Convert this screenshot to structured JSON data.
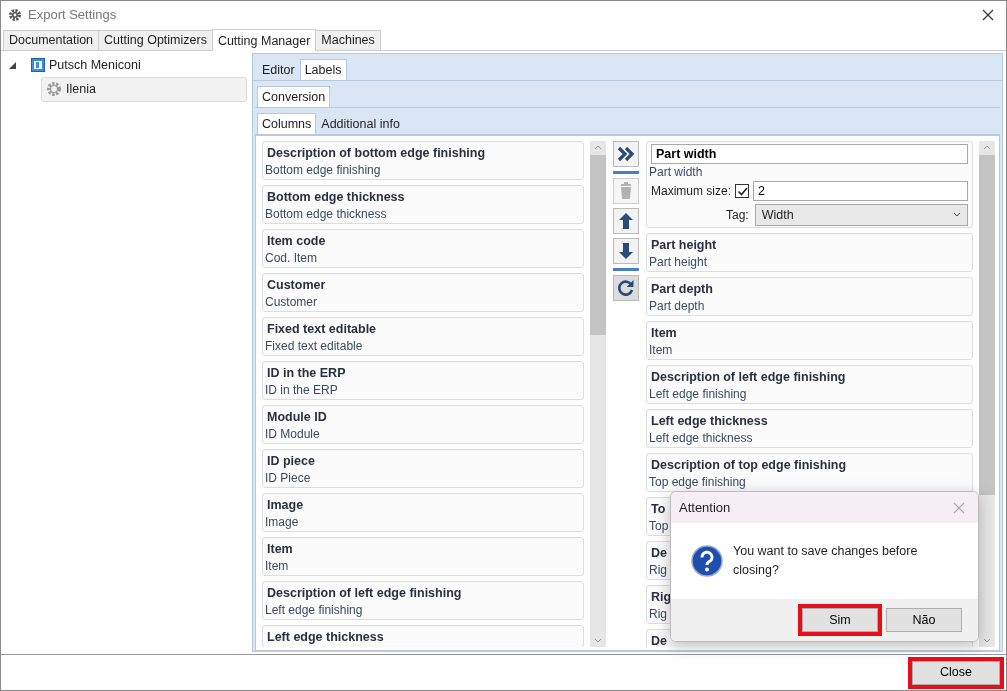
{
  "window": {
    "title": "Export Settings"
  },
  "tabs": [
    {
      "label": "Documentation",
      "selected": false
    },
    {
      "label": "Cutting Optimizers",
      "selected": false
    },
    {
      "label": "Cutting Manager",
      "selected": true
    },
    {
      "label": "Machines",
      "selected": false
    }
  ],
  "tree": [
    {
      "label": "Putsch Meniconi",
      "expanded": true,
      "selected": false,
      "children": [
        {
          "label": "Ilenia",
          "selected": true
        }
      ]
    }
  ],
  "sub_tabs": [
    {
      "label": "Editor",
      "selected": false
    },
    {
      "label": "Labels",
      "selected": true
    }
  ],
  "conversion_tabs": [
    {
      "label": "Conversion",
      "selected": true
    }
  ],
  "column_tabs": [
    {
      "label": "Columns",
      "selected": true
    },
    {
      "label": "Additional info",
      "selected": false
    }
  ],
  "available_columns": [
    {
      "title": "Description of bottom edge finishing",
      "subtitle": "Bottom edge finishing"
    },
    {
      "title": "Bottom edge thickness",
      "subtitle": "Bottom edge thickness"
    },
    {
      "title": "Item code",
      "subtitle": "Cod. Item"
    },
    {
      "title": "Customer",
      "subtitle": "Customer"
    },
    {
      "title": "Fixed text editable",
      "subtitle": "Fixed text editable"
    },
    {
      "title": "ID in the ERP",
      "subtitle": "ID in the ERP"
    },
    {
      "title": "Module ID",
      "subtitle": "ID Module"
    },
    {
      "title": "ID piece",
      "subtitle": "ID Piece"
    },
    {
      "title": "Image",
      "subtitle": "Image"
    },
    {
      "title": "Item",
      "subtitle": "Item"
    },
    {
      "title": "Description of left edge finishing",
      "subtitle": "Left edge finishing"
    },
    {
      "title": "Left edge thickness"
    }
  ],
  "toolbar": [
    {
      "kind": "add",
      "disabled": false
    },
    {
      "kind": "separator"
    },
    {
      "kind": "delete",
      "disabled": true
    },
    {
      "kind": "up",
      "disabled": false
    },
    {
      "kind": "down",
      "disabled": false
    },
    {
      "kind": "separator"
    },
    {
      "kind": "refresh",
      "disabled": false
    }
  ],
  "selected_columns": [
    {
      "title": "Part width",
      "subtitle": "Part width",
      "expanded": true,
      "max_size_label": "Maximum size:",
      "max_size_checked": true,
      "max_size": "2",
      "tag_label": "Tag:",
      "tag": "Width"
    },
    {
      "title": "Part height",
      "subtitle": "Part height",
      "expanded": false
    },
    {
      "title": "Part depth",
      "subtitle": "Part depth",
      "expanded": false
    },
    {
      "title": "Item",
      "subtitle": "Item",
      "expanded": false
    },
    {
      "title": "Description of left edge finishing",
      "subtitle": "Left edge finishing",
      "expanded": false
    },
    {
      "title": "Left edge thickness",
      "subtitle": "Left edge thickness",
      "expanded": false
    },
    {
      "title": "Description of top edge finishing",
      "subtitle": "Top edge finishing",
      "expanded": false
    },
    {
      "title": "To",
      "subtitle": "Top",
      "expanded": false
    },
    {
      "title": "De",
      "subtitle": "Rig",
      "expanded": false
    },
    {
      "title": "Rig",
      "subtitle": "Rig",
      "expanded": false
    },
    {
      "title": "De",
      "expanded": false
    }
  ],
  "dialog": {
    "title": "Attention",
    "message": "You want to save changes before closing?",
    "buttons": [
      {
        "label": "Sim",
        "highlighted": true
      },
      {
        "label": "Não",
        "highlighted": false
      }
    ]
  },
  "footer": {
    "buttons": [
      {
        "label": "Close",
        "highlighted": true
      }
    ]
  }
}
